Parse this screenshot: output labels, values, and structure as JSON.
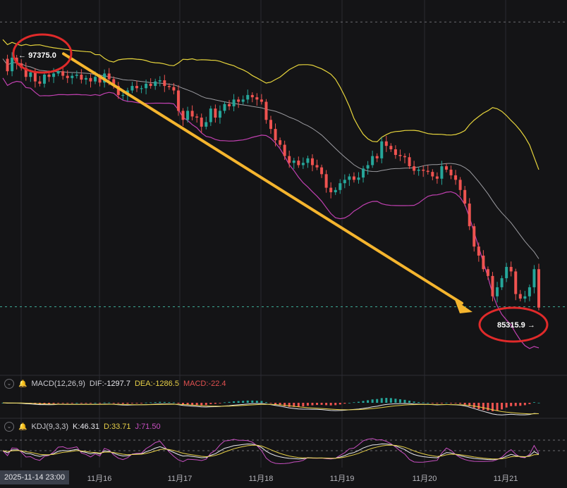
{
  "chart_data": {
    "type": "candlestick",
    "colors": {
      "up": "#26a69a",
      "down": "#ef5350",
      "bollinger_upper": "#e6d43c",
      "bollinger_mid": "#9b9ba0",
      "bollinger_lower": "#c040b0",
      "annotation_arrow": "#f5b52e",
      "annotation_circle": "#e02a2a",
      "grid": "#2a2a30"
    },
    "price_range": [
      83000,
      99500
    ],
    "x_ticks": [
      "11月16",
      "11月17",
      "11月18",
      "11月19",
      "11月20",
      "11月21"
    ],
    "start_date_label": "2025-11-14 23:00",
    "high_label": "97375.0",
    "low_label": "85315.9",
    "high_marker_symbol": "←",
    "low_marker_symbol": "→",
    "close_series": [
      96900,
      96350,
      96950,
      96700,
      96500,
      96100,
      96300,
      95900,
      95800,
      96200,
      96100,
      96250,
      96350,
      96150,
      96050,
      96150,
      96200,
      95980,
      96050,
      95900,
      96100,
      95850,
      96250,
      96000,
      95700,
      95300,
      95300,
      95500,
      95700,
      95600,
      95600,
      95800,
      95700,
      95900,
      95950,
      95700,
      95650,
      95500,
      94600,
      94200,
      94600,
      94350,
      94300,
      93900,
      94100,
      94700,
      94300,
      94600,
      94900,
      94800,
      95100,
      95000,
      95100,
      95300,
      95200,
      95100,
      95000,
      94200,
      93800,
      93300,
      93100,
      92600,
      92300,
      92400,
      92200,
      92300,
      92500,
      92200,
      92100,
      91800,
      91200,
      91000,
      91100,
      91400,
      91550,
      91700,
      91550,
      91650,
      92050,
      92200,
      92600,
      92500,
      93250,
      93050,
      92900,
      92650,
      92600,
      92550,
      92150,
      91950,
      92000,
      91950,
      91900,
      91700,
      91600,
      92150,
      92000,
      91750,
      91550,
      91100,
      90500,
      89500,
      88600,
      88200,
      87600,
      87300,
      86400,
      86800,
      87200,
      87700,
      87500,
      86500,
      86300,
      86400,
      86800,
      87600,
      85900
    ],
    "macd": {
      "label": "MACD(12,26,9)",
      "dif_label": "DIF:",
      "dif": "-1297.7",
      "dea_label": "DEA:",
      "dea": "-1286.5",
      "macd_label": "MACD:",
      "macd": "-22.4"
    },
    "kdj": {
      "label": "KDJ(9,3,3)",
      "k_label": "K:",
      "k": "46.31",
      "d_label": "D:",
      "d": "33.71",
      "j_label": "J:",
      "j": "71.50"
    }
  }
}
